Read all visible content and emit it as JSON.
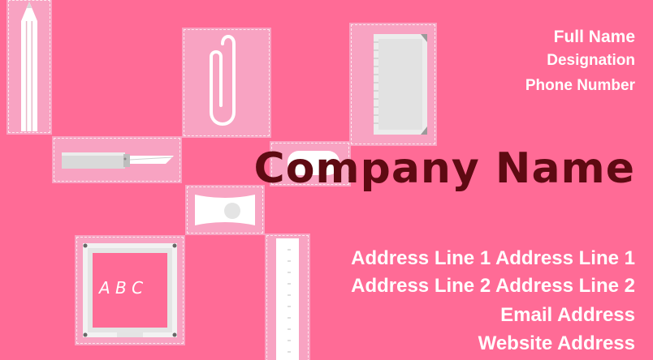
{
  "card": {
    "background_color": "#ff6b96",
    "tile_color": "#f8a3c2",
    "company_color": "#5e0a12",
    "full_name": "Full Name",
    "designation": "Designation",
    "phone": "Phone Number",
    "company_name": "Company Name",
    "address_line_1": "Address Line 1 Address Line 1",
    "address_line_2": "Address Line 2 Address Line 2",
    "email": "Email Address",
    "website": "Website Address"
  },
  "illustrations": {
    "pencil": "pencil-icon",
    "paperclip": "paperclip-icon",
    "notepad": "notepad-icon",
    "cutter": "cutter-knife-icon",
    "eraser": "eraser-icon",
    "sharpener": "sharpener-icon",
    "slate": "slate-board-icon",
    "slate_text": "A B C",
    "ruler": "ruler-icon"
  }
}
